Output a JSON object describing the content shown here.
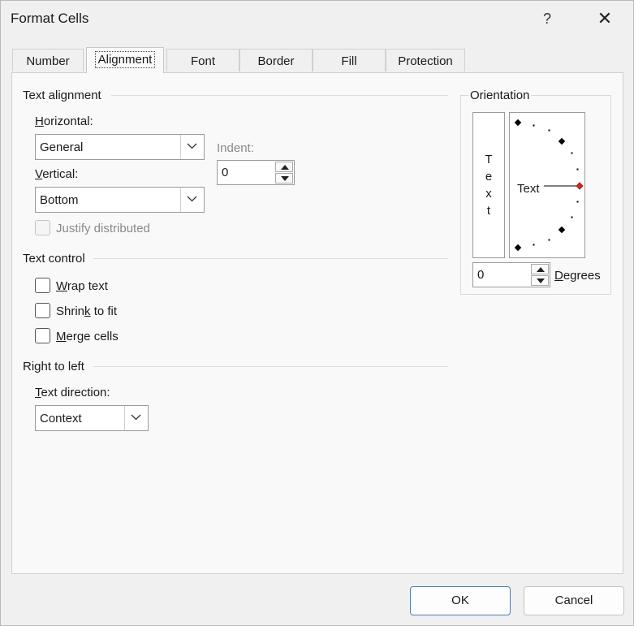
{
  "window": {
    "title": "Format Cells",
    "help": "?",
    "close": "✕"
  },
  "tabs": [
    "Number",
    "Alignment",
    "Font",
    "Border",
    "Fill",
    "Protection"
  ],
  "active_tab": "Alignment",
  "text_alignment": {
    "group_label": "Text alignment",
    "horizontal": {
      "label_u": "H",
      "label_rest": "orizontal:",
      "value": "General"
    },
    "vertical": {
      "label_u": "V",
      "label_rest": "ertical:",
      "value": "Bottom"
    },
    "indent": {
      "label": "Indent:",
      "value": "0"
    },
    "justify_distributed": {
      "label": "Justify distributed",
      "checked": false,
      "enabled": false
    }
  },
  "text_control": {
    "group_label": "Text control",
    "wrap_text": {
      "label_u": "W",
      "label_rest": "rap text",
      "checked": false
    },
    "shrink_to_fit": {
      "label_pre": "Shrin",
      "label_u": "k",
      "label_rest": " to fit",
      "checked": false
    },
    "merge_cells": {
      "label_u": "M",
      "label_rest": "erge cells",
      "checked": false
    }
  },
  "right_to_left": {
    "group_label": "Right to left",
    "text_direction": {
      "label_u": "T",
      "label_rest": "ext direction:",
      "value": "Context"
    }
  },
  "orientation": {
    "group_label": "Orientation",
    "vertical_text_letters": [
      "T",
      "e",
      "x",
      "t"
    ],
    "dial_text": "Text",
    "degrees_value": "0",
    "degrees_label_u": "D",
    "degrees_label_rest": "egrees"
  },
  "buttons": {
    "ok": "OK",
    "cancel": "Cancel"
  },
  "colors": {
    "accent_border": "#4a7fb8",
    "dial_marker_active": "#d22222",
    "dial_marker": "#000000"
  },
  "icons": {
    "dropdown": "chevron-down-icon",
    "spin_up": "spin-up-icon",
    "spin_down": "spin-down-icon"
  }
}
